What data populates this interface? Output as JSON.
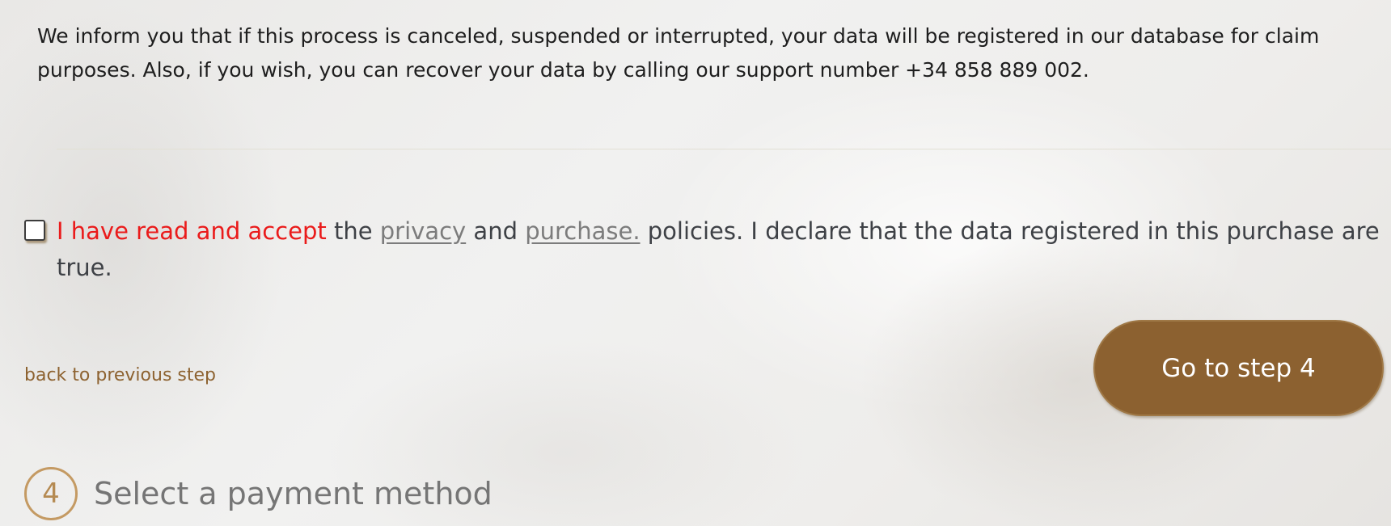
{
  "notice": {
    "text": "We inform you that if this process is canceled, suspended or interrupted, your data will be registered in our database for claim purposes. Also, if you wish, you can recover your data by calling our support number +34 858 889 002."
  },
  "consent": {
    "checked": false,
    "accept_text": "I have read and accept",
    "the_text": " the ",
    "privacy_link": "privacy",
    "and_text": " and ",
    "purchase_link": "purchase.",
    "rest_text": " policies. I declare that the data registered in this purchase are true."
  },
  "navigation": {
    "back_label": "back to previous step",
    "next_label": "Go to step 4"
  },
  "next_step": {
    "number": "4",
    "title": "Select a payment method"
  },
  "colors": {
    "accent_brown": "#8c6130",
    "required_red": "#ea1b1b",
    "step_ring": "#c49a63"
  }
}
